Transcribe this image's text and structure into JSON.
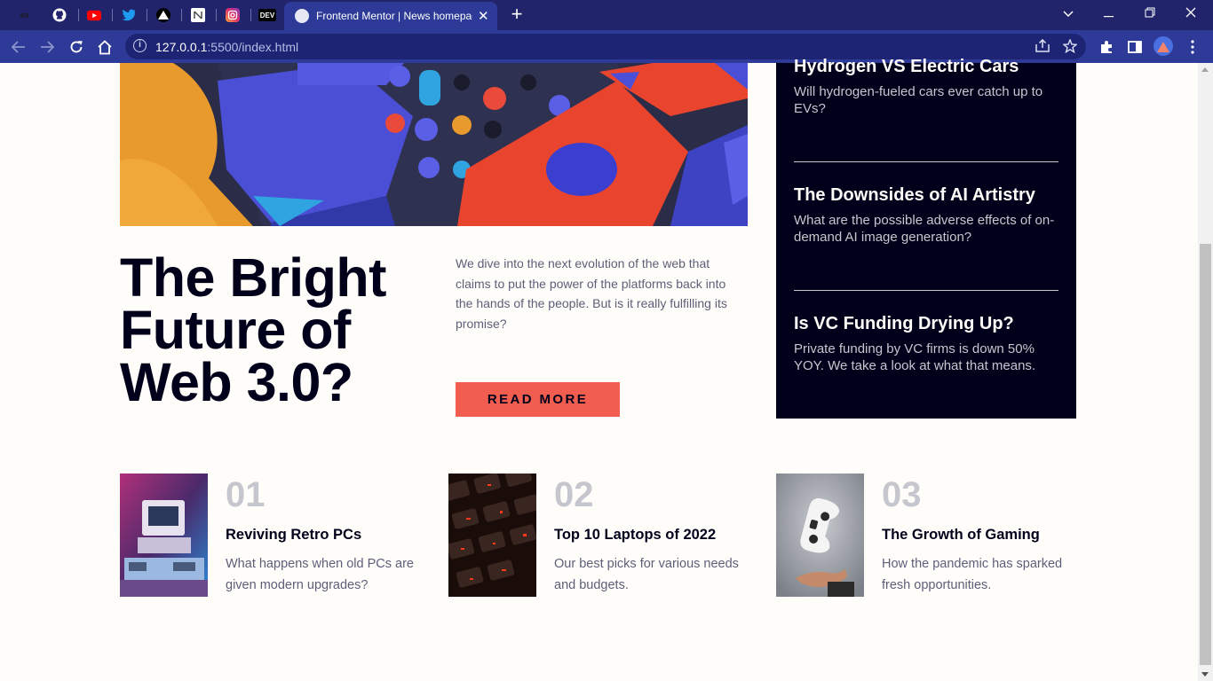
{
  "browser": {
    "pinned_tabs": [
      {
        "name": "pinned-tab-eraser",
        "label": "ex"
      },
      {
        "name": "pinned-tab-github",
        "label": ""
      },
      {
        "name": "pinned-tab-youtube",
        "label": ""
      },
      {
        "name": "pinned-tab-twitter",
        "label": ""
      },
      {
        "name": "pinned-tab-vercel",
        "label": ""
      },
      {
        "name": "pinned-tab-notion",
        "label": ""
      },
      {
        "name": "pinned-tab-instagram",
        "label": ""
      },
      {
        "name": "pinned-tab-dev",
        "label": "DEV"
      }
    ],
    "active_tab_title": "Frontend Mentor | News homepage",
    "close_glyph": "✕",
    "newtab_glyph": "+",
    "url_host": "127.0.0.1",
    "url_rest": ":5500/index.html",
    "colors": {
      "tabbar": "#22246b",
      "toolbar": "#2d3a97",
      "omnibox": "#1d2474"
    }
  },
  "hero": {
    "title": "The Bright Future of Web 3.0?",
    "description": "We dive into the next evolution of the web that claims to put the power of the platforms back into the hands of the people. But is it really fulfilling its promise?",
    "button": "READ MORE"
  },
  "sidebar": {
    "items": [
      {
        "title": "Hydrogen VS Electric Cars",
        "desc": "Will hydrogen-fueled cars ever catch up to EVs?"
      },
      {
        "title": "The Downsides of AI Artistry",
        "desc": "What are the possible adverse effects of on-demand AI image generation?"
      },
      {
        "title": "Is VC Funding Drying Up?",
        "desc": "Private funding by VC firms is down 50% YOY. We take a look at what that means."
      }
    ]
  },
  "cards": [
    {
      "num": "01",
      "title": "Reviving Retro PCs",
      "desc": "What happens when old PCs are given modern upgrades?"
    },
    {
      "num": "02",
      "title": "Top 10 Laptops of 2022",
      "desc": "Our best picks for various needs and budgets."
    },
    {
      "num": "03",
      "title": "The Growth of Gaming",
      "desc": "How the pandemic has sparked fresh opportunities."
    }
  ],
  "theme": {
    "accent": "#f15e50",
    "dark": "#00001a",
    "muted": "#5d5f79",
    "light_gray": "#c5c6ce",
    "background": "#fffdf9"
  }
}
